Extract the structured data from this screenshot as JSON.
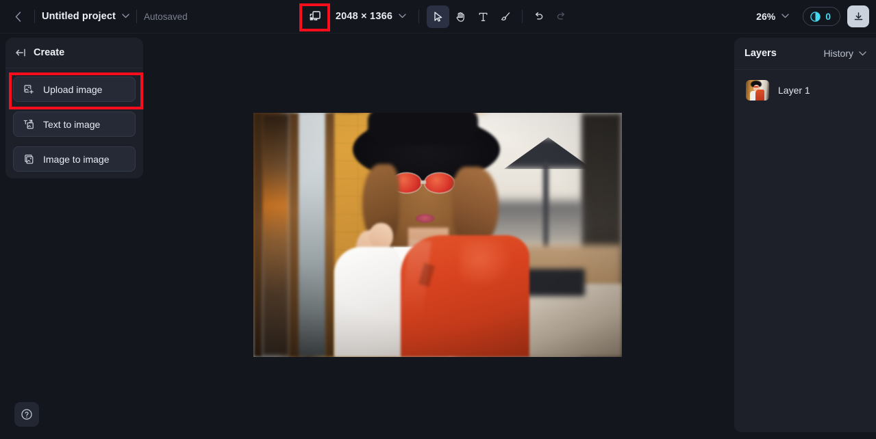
{
  "app": {
    "accent_cyan": "#45d6f0",
    "annotation_color": "#fc0d1b",
    "panel_bg": "#1d2029",
    "canvas_bg": "#14161d"
  },
  "header": {
    "back_label": "‹",
    "project_title": "Untitled project",
    "project_chevron": "⌄",
    "autosaved": "Autosaved",
    "resize_icon": "resize-canvas-icon",
    "dimensions": "2048 × 1366",
    "dimensions_chevron": "⌄",
    "tools": [
      {
        "name": "select",
        "glyph": "select-arrow-icon",
        "active": true,
        "disabled": false
      },
      {
        "name": "hand",
        "glyph": "hand-icon",
        "active": false,
        "disabled": false
      },
      {
        "name": "text",
        "glyph": "text-icon",
        "active": false,
        "disabled": false
      },
      {
        "name": "brush",
        "glyph": "brush-icon",
        "active": false,
        "disabled": false
      },
      {
        "name": "undo",
        "glyph": "undo-icon",
        "active": false,
        "disabled": false
      },
      {
        "name": "redo",
        "glyph": "redo-icon",
        "active": false,
        "disabled": true
      }
    ],
    "zoom_level": "26%",
    "zoom_chevron": "⌄",
    "credits_count": "0",
    "credits_icon": "credits-coin-icon",
    "download_icon": "download-icon"
  },
  "left_panel": {
    "title": "Create",
    "collapse_icon": "collapse-panel-icon",
    "items": [
      {
        "label": "Upload image",
        "icon": "upload-image-icon",
        "highlighted": true
      },
      {
        "label": "Text to image",
        "icon": "text-to-image-icon",
        "highlighted": false
      },
      {
        "label": "Image to image",
        "icon": "image-to-image-icon",
        "highlighted": false
      }
    ]
  },
  "right_panel": {
    "title": "Layers",
    "history_label": "History",
    "history_chevron": "⌄",
    "layers": [
      {
        "name": "Layer 1",
        "thumbnail": "photo-woman-red-blazer"
      }
    ]
  },
  "canvas": {
    "artboard_content": "photo-woman-black-hat-red-sunglasses-red-blazer-outdoor-cafe"
  },
  "footer": {
    "help_icon": "help-question-icon",
    "help_label": "?"
  }
}
